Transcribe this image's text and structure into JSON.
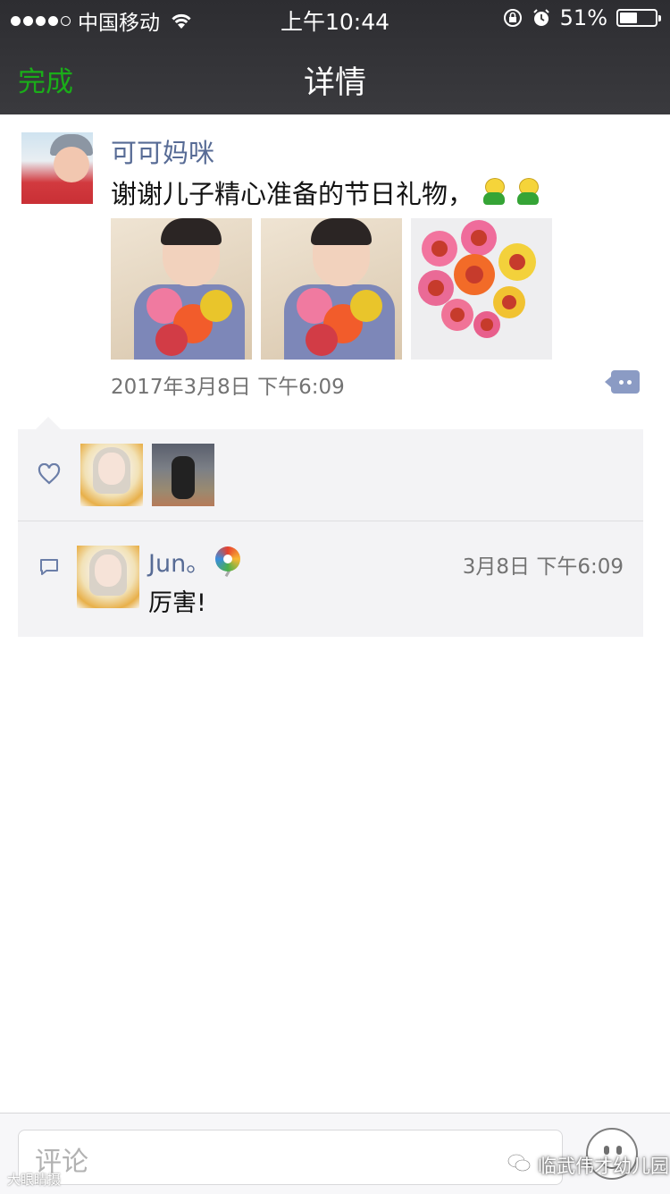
{
  "status_bar": {
    "carrier": "中国移动",
    "time": "上午10:44",
    "battery": "51%",
    "battery_level": 0.51,
    "signal_dots_filled": 4,
    "signal_dots_total": 5
  },
  "nav": {
    "done_label": "完成",
    "title": "详情"
  },
  "post": {
    "author": "可可妈咪",
    "text": "谢谢儿子精心准备的节日礼物，",
    "emoji_count": 2,
    "photo_count": 3,
    "timestamp": "2017年3月8日 下午6:09"
  },
  "comments": [
    {
      "author": "Jun。",
      "time": "3月8日 下午6:09",
      "text": "厉害!"
    }
  ],
  "comment_bar": {
    "placeholder": "评论"
  },
  "watermarks": {
    "bottom_left": "大眼睛摄",
    "account": "临武伟才幼儿园"
  },
  "colors": {
    "accent_green": "#1aad19",
    "link_blue": "#576b95",
    "header_dark": "#333337",
    "panel_gray": "#f3f3f5"
  },
  "icons": [
    "wifi-icon",
    "lock-rotation-icon",
    "alarm-icon",
    "battery-icon",
    "more-icon",
    "heart-icon",
    "comment-icon",
    "emoji-face-icon"
  ]
}
